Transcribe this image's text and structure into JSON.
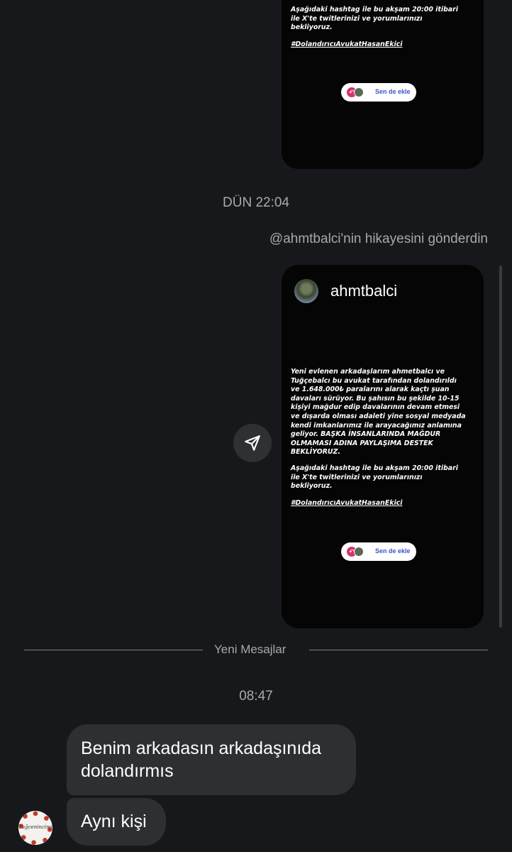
{
  "colors": {
    "background": "#17181c",
    "bubble": "#2e2f33",
    "muted_text": "#a8a9ad",
    "story_bg": "#050505",
    "sticker_link": "#3c54c8",
    "sticker_avatar": "#d8336c"
  },
  "top_story": {
    "text": "Aşağıdaki hashtag ile bu akşam 20:00 itibari\nile X'te twitlerinizi ve yorumlarınızı\nbekliyoruz.",
    "hashtag": "#DolandırıcıAvukatHasanEkici",
    "sticker": {
      "label": "Sen de ekle",
      "icon": "arrow-back-icon"
    }
  },
  "timestamp_1": "DÜN 22:04",
  "reply_note": "@ahmtbalci'nin hikayesini gönderdin",
  "shared_story": {
    "username": "ahmtbalci",
    "text": "Yeni evlenen arkadaşlarım ahmetbalcı ve\nTuğçebalcı bu avukat tarafından dolandırıldı\nve 1.648.000₺ paralarını alarak kaçtı şuan\ndavaları sürüyor. Bu şahısın bu şekilde 10-15\nkişiyi mağdur edip davalarının devam etmesi\nve dışarda olması adaleti yine sosyal medyada\nkendi imkanlarımız ile arayacağımız anlamına\ngeliyor. BAŞKA İNSANLARINDA MAĞDUR\nOLMAMASI ADINA PAYLAŞIMA DESTEK\nBEKLİYORUZ.",
    "text2": "Aşağıdaki hashtag ile bu akşam 20:00 itibari\nile X'te twitlerinizi ve yorumlarınızı\nbekliyoruz.",
    "hashtag": "#DolandırıcıAvukatHasanEkici",
    "sticker": {
      "label": "Sen de ekle",
      "icon": "arrow-back-icon"
    }
  },
  "share_button": {
    "icon": "send-icon"
  },
  "divider": {
    "label": "Yeni Mesajlar"
  },
  "timestamp_2": "08:47",
  "messages": [
    {
      "text": "Benim arkadasın arkadaşınıda dolandırmıs"
    },
    {
      "text": "Aynı kişi"
    }
  ],
  "sender_avatar": {
    "text": "Tuğcenincimiçerisi"
  }
}
